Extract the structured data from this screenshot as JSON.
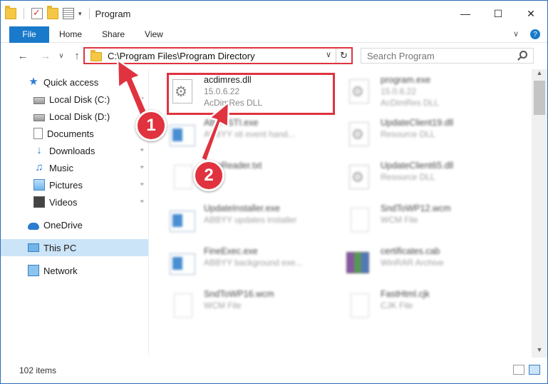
{
  "window": {
    "title": "Program",
    "minimize": "—",
    "maximize": "☐",
    "close": "✕"
  },
  "ribbon": {
    "tabs": [
      "File",
      "Home",
      "Share",
      "View"
    ],
    "expand": "∨",
    "help": "?"
  },
  "nav": {
    "back": "←",
    "forward": "→",
    "recent": "∨",
    "up": "↑",
    "address": "C:\\Program Files\\Program Directory",
    "address_dropdown": "∨",
    "refresh": "↻",
    "search_placeholder": "Search Program"
  },
  "sidebar": {
    "items": [
      {
        "label": "Quick access",
        "icon": "star-icon"
      },
      {
        "label": "Local Disk (C:)",
        "icon": "drive-icon"
      },
      {
        "label": "Local Disk (D:)",
        "icon": "drive-icon"
      },
      {
        "label": "Documents",
        "icon": "documents-icon"
      },
      {
        "label": "Downloads",
        "icon": "downloads-icon"
      },
      {
        "label": "Music",
        "icon": "music-icon"
      },
      {
        "label": "Pictures",
        "icon": "pictures-icon"
      },
      {
        "label": "Videos",
        "icon": "videos-icon"
      },
      {
        "label": "OneDrive",
        "icon": "onedrive-icon"
      },
      {
        "label": "This PC",
        "icon": "this-pc-icon"
      },
      {
        "label": "Network",
        "icon": "network-icon"
      }
    ],
    "pin_glyph": "⌖"
  },
  "files": {
    "left": [
      {
        "name": "acdimres.dll",
        "version": "15.0.6.22",
        "type": "AcDimRes DLL",
        "icon": "dll-icon"
      },
      {
        "name": "ABBYSTI.exe",
        "version": "",
        "type": "ABBYY sti event hand...",
        "icon": "exe-icon"
      },
      {
        "name": "FineReader.txt",
        "version": "",
        "type": "",
        "icon": "text-file-icon"
      },
      {
        "name": "UpdateInstaller.exe",
        "version": "",
        "type": "ABBYY updates installer",
        "icon": "exe-icon"
      },
      {
        "name": "FineExec.exe",
        "version": "",
        "type": "ABBYY background exe...",
        "icon": "exe-icon"
      },
      {
        "name": "SndToWP16.wcm",
        "version": "",
        "type": "WCM File",
        "icon": "file-icon"
      }
    ],
    "right": [
      {
        "name": "program.exe",
        "version": "15.0.6.22",
        "type": "AcDimRes DLL",
        "icon": "program-exe-icon"
      },
      {
        "name": "UpdateClient19.dll",
        "version": "",
        "type": "Resource DLL",
        "icon": "dll-icon"
      },
      {
        "name": "UpdateClient65.dll",
        "version": "",
        "type": "Resource DLL",
        "icon": "dll-icon"
      },
      {
        "name": "SndToWP12.wcm",
        "version": "",
        "type": "WCM File",
        "icon": "file-icon"
      },
      {
        "name": "certificates.cab",
        "version": "",
        "type": "WinRAR Archive",
        "icon": "winrar-icon"
      },
      {
        "name": "FastHtml.cjk",
        "version": "",
        "type": "CJK File",
        "icon": "file-icon"
      }
    ]
  },
  "callouts": [
    "1",
    "2"
  ],
  "status": {
    "item_count": "102 items"
  },
  "colors": {
    "accent": "#1979ca",
    "highlight": "#e0333f",
    "selected": "#cce4f7"
  }
}
